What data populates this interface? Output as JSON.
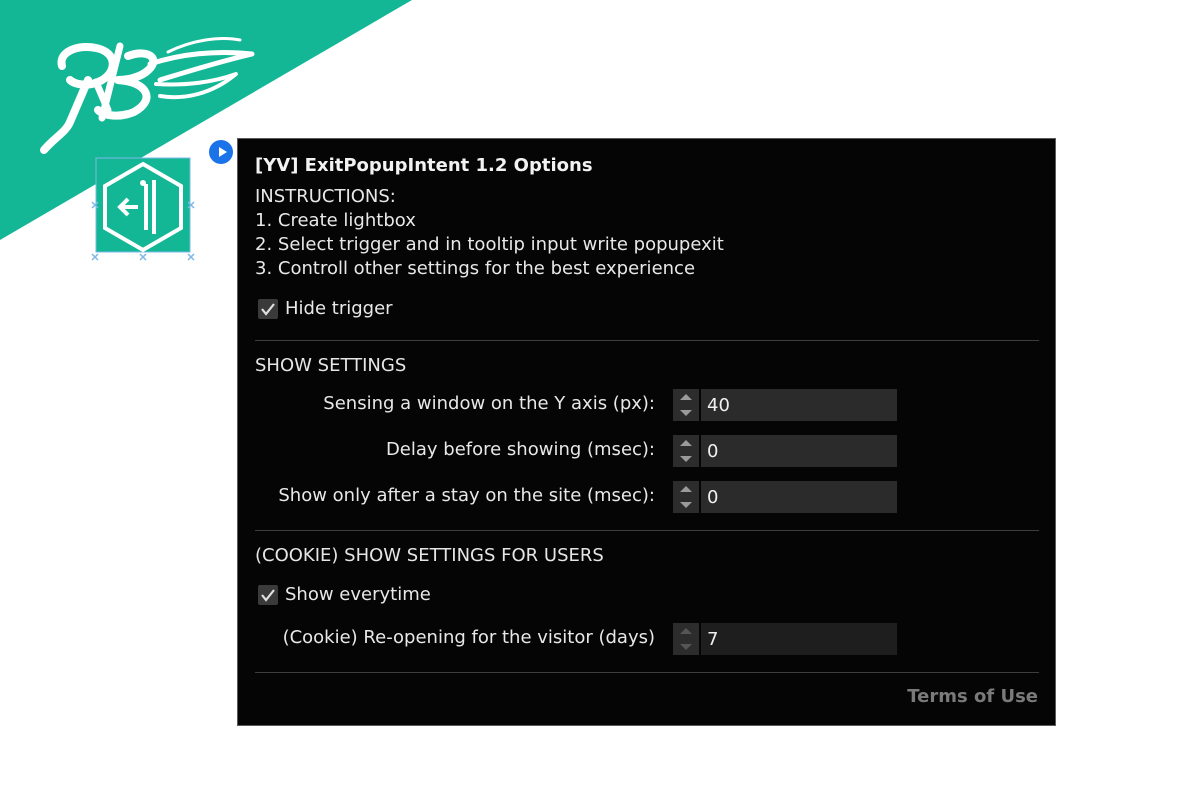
{
  "colors": {
    "brand_teal": "#13b795",
    "panel_bg": "#050505",
    "accent_blue": "#1a73e8"
  },
  "icons": {
    "logo": "rb-script-logo-icon",
    "widget": "exit-arrow-hexagon-icon",
    "play": "play-icon",
    "check": "checkmark-icon"
  },
  "panel": {
    "title": "[YV] ExitPopupIntent 1.2 Options",
    "instructions": [
      "INSTRUCTIONS:",
      "1. Create lightbox",
      "2. Select trigger and in tooltip input write popupexit",
      "3. Controll other settings for the best experience"
    ],
    "hide_trigger": {
      "label": "Hide trigger",
      "checked": true
    },
    "show_settings": {
      "heading": "SHOW SETTINGS",
      "fields": [
        {
          "label": "Sensing a window on the Y axis (px):",
          "value": "40"
        },
        {
          "label": "Delay before showing (msec):",
          "value": "0"
        },
        {
          "label": "Show only after a stay on the site (msec):",
          "value": "0"
        }
      ]
    },
    "cookie_settings": {
      "heading": "(COOKIE) SHOW SETTINGS FOR USERS",
      "show_everytime": {
        "label": "Show everytime",
        "checked": true
      },
      "reopen": {
        "label": "(Cookie) Re-opening for the visitor (days)",
        "value": "7"
      }
    },
    "terms_link": "Terms of Use"
  }
}
